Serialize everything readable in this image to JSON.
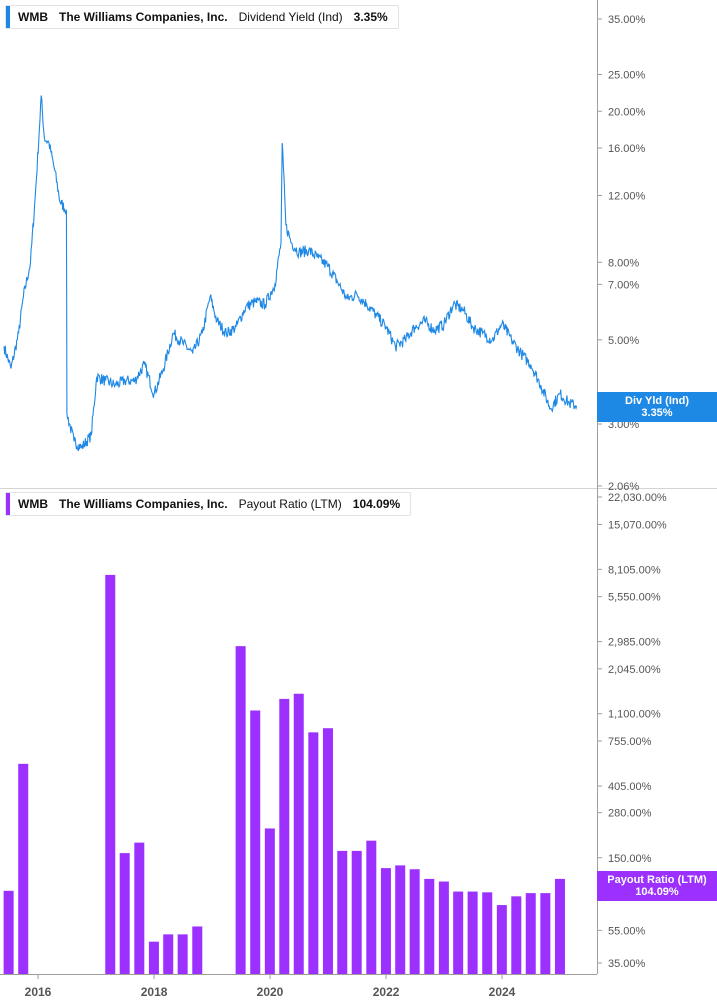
{
  "colors": {
    "div_yield": "#1e88e5",
    "payout": "#9b30ff",
    "axis": "#9e9e9e",
    "text": "#555555"
  },
  "top_legend": {
    "ticker": "WMB",
    "company": "The Williams Companies, Inc.",
    "metric": "Dividend Yield (Ind)",
    "value": "3.35%"
  },
  "bottom_legend": {
    "ticker": "WMB",
    "company": "The Williams Companies, Inc.",
    "metric": "Payout Ratio (LTM)",
    "value": "104.09%"
  },
  "top_flag": {
    "label": "Div Yld (Ind)",
    "value": "3.35%"
  },
  "bottom_flag": {
    "label": "Payout Ratio (LTM)",
    "value": "104.09%"
  },
  "x_axis": {
    "ticks": [
      "2016",
      "2018",
      "2020",
      "2022",
      "2024"
    ]
  },
  "chart_data": [
    {
      "type": "line",
      "name": "Dividend Yield (Ind)",
      "y_scale": "log",
      "ylim": [
        2.06,
        38
      ],
      "y_ticks": [
        {
          "v": 35,
          "label": "35.00%"
        },
        {
          "v": 25,
          "label": "25.00%"
        },
        {
          "v": 20,
          "label": "20.00%"
        },
        {
          "v": 16,
          "label": "16.00%"
        },
        {
          "v": 12,
          "label": "12.00%"
        },
        {
          "v": 8,
          "label": "8.00%"
        },
        {
          "v": 7,
          "label": "7.00%"
        },
        {
          "v": 5,
          "label": "5.00%"
        },
        {
          "v": 3,
          "label": "3.00%"
        },
        {
          "v": 2.06,
          "label": "2.06%"
        }
      ],
      "points": [
        [
          "2015-06-01",
          4.8
        ],
        [
          "2015-07-15",
          4.2
        ],
        [
          "2015-09-01",
          5.2
        ],
        [
          "2015-10-01",
          6.5
        ],
        [
          "2015-11-15",
          8.0
        ],
        [
          "2015-12-15",
          12.0
        ],
        [
          "2016-01-10",
          18.0
        ],
        [
          "2016-01-21",
          22.0
        ],
        [
          "2016-02-10",
          17.0
        ],
        [
          "2016-03-10",
          16.5
        ],
        [
          "2016-04-15",
          14.0
        ],
        [
          "2016-05-20",
          11.5
        ],
        [
          "2016-06-28",
          11.0
        ],
        [
          "2016-07-01",
          3.2
        ],
        [
          "2016-08-15",
          2.7
        ],
        [
          "2016-10-01",
          2.6
        ],
        [
          "2016-12-01",
          2.8
        ],
        [
          "2017-01-05",
          4.0
        ],
        [
          "2017-03-01",
          3.9
        ],
        [
          "2017-05-01",
          3.8
        ],
        [
          "2017-07-01",
          3.9
        ],
        [
          "2017-09-01",
          3.9
        ],
        [
          "2017-11-01",
          4.3
        ],
        [
          "2018-01-01",
          3.6
        ],
        [
          "2018-03-01",
          4.2
        ],
        [
          "2018-05-01",
          5.2
        ],
        [
          "2018-07-01",
          4.9
        ],
        [
          "2018-09-01",
          4.6
        ],
        [
          "2018-11-01",
          5.2
        ],
        [
          "2018-12-20",
          6.5
        ],
        [
          "2019-02-01",
          5.6
        ],
        [
          "2019-04-01",
          5.2
        ],
        [
          "2019-06-01",
          5.4
        ],
        [
          "2019-08-01",
          6.1
        ],
        [
          "2019-10-01",
          6.3
        ],
        [
          "2019-12-01",
          6.2
        ],
        [
          "2020-02-01",
          7.0
        ],
        [
          "2020-03-10",
          9.0
        ],
        [
          "2020-03-18",
          16.5
        ],
        [
          "2020-04-10",
          10.0
        ],
        [
          "2020-05-15",
          9.0
        ],
        [
          "2020-07-01",
          8.5
        ],
        [
          "2020-09-01",
          8.6
        ],
        [
          "2020-11-01",
          8.2
        ],
        [
          "2021-01-01",
          7.8
        ],
        [
          "2021-03-01",
          7.1
        ],
        [
          "2021-05-01",
          6.4
        ],
        [
          "2021-07-01",
          6.6
        ],
        [
          "2021-09-01",
          6.2
        ],
        [
          "2021-11-01",
          5.8
        ],
        [
          "2022-01-01",
          5.4
        ],
        [
          "2022-03-01",
          4.8
        ],
        [
          "2022-05-01",
          5.0
        ],
        [
          "2022-07-01",
          5.4
        ],
        [
          "2022-09-01",
          5.6
        ],
        [
          "2022-11-01",
          5.3
        ],
        [
          "2023-01-01",
          5.5
        ],
        [
          "2023-03-01",
          6.2
        ],
        [
          "2023-05-01",
          6.0
        ],
        [
          "2023-07-01",
          5.4
        ],
        [
          "2023-09-01",
          5.2
        ],
        [
          "2023-11-01",
          5.0
        ],
        [
          "2024-01-01",
          5.5
        ],
        [
          "2024-03-01",
          5.0
        ],
        [
          "2024-05-01",
          4.6
        ],
        [
          "2024-07-01",
          4.3
        ],
        [
          "2024-09-01",
          3.8
        ],
        [
          "2024-11-01",
          3.3
        ],
        [
          "2025-01-01",
          3.6
        ],
        [
          "2025-03-01",
          3.4
        ],
        [
          "2025-04-15",
          3.35
        ]
      ]
    },
    {
      "type": "bar",
      "name": "Payout Ratio (LTM)",
      "y_scale": "log",
      "ylim": [
        30,
        24000
      ],
      "y_ticks": [
        {
          "v": 22030,
          "label": "22,030.00%"
        },
        {
          "v": 15070,
          "label": "15,070.00%"
        },
        {
          "v": 8105,
          "label": "8,105.00%"
        },
        {
          "v": 5550,
          "label": "5,550.00%"
        },
        {
          "v": 2985,
          "label": "2,985.00%"
        },
        {
          "v": 2045,
          "label": "2,045.00%"
        },
        {
          "v": 1100,
          "label": "1,100.00%"
        },
        {
          "v": 755,
          "label": "755.00%"
        },
        {
          "v": 405,
          "label": "405.00%"
        },
        {
          "v": 280,
          "label": "280.00%"
        },
        {
          "v": 150,
          "label": "150.00%"
        },
        {
          "v": 55,
          "label": "55.00%"
        },
        {
          "v": 35,
          "label": "35.00%"
        }
      ],
      "bars": [
        [
          "2015-06-30",
          95
        ],
        [
          "2015-09-30",
          550
        ],
        [
          "2017-03-31",
          7500
        ],
        [
          "2017-06-30",
          160
        ],
        [
          "2017-09-30",
          185
        ],
        [
          "2017-12-31",
          47
        ],
        [
          "2018-03-31",
          52
        ],
        [
          "2018-06-30",
          52
        ],
        [
          "2018-09-30",
          58
        ],
        [
          "2019-06-30",
          2800
        ],
        [
          "2019-09-30",
          1150
        ],
        [
          "2019-12-31",
          225
        ],
        [
          "2020-03-31",
          1350
        ],
        [
          "2020-06-30",
          1450
        ],
        [
          "2020-09-30",
          850
        ],
        [
          "2020-12-31",
          900
        ],
        [
          "2021-03-31",
          165
        ],
        [
          "2021-06-30",
          165
        ],
        [
          "2021-09-30",
          190
        ],
        [
          "2021-12-31",
          130
        ],
        [
          "2022-03-31",
          135
        ],
        [
          "2022-06-30",
          128
        ],
        [
          "2022-09-30",
          112
        ],
        [
          "2022-12-31",
          108
        ],
        [
          "2023-03-31",
          94
        ],
        [
          "2023-06-30",
          94
        ],
        [
          "2023-09-30",
          93
        ],
        [
          "2023-12-31",
          78
        ],
        [
          "2024-03-31",
          88
        ],
        [
          "2024-06-30",
          92
        ],
        [
          "2024-09-30",
          92
        ],
        [
          "2024-12-31",
          112
        ]
      ]
    }
  ]
}
